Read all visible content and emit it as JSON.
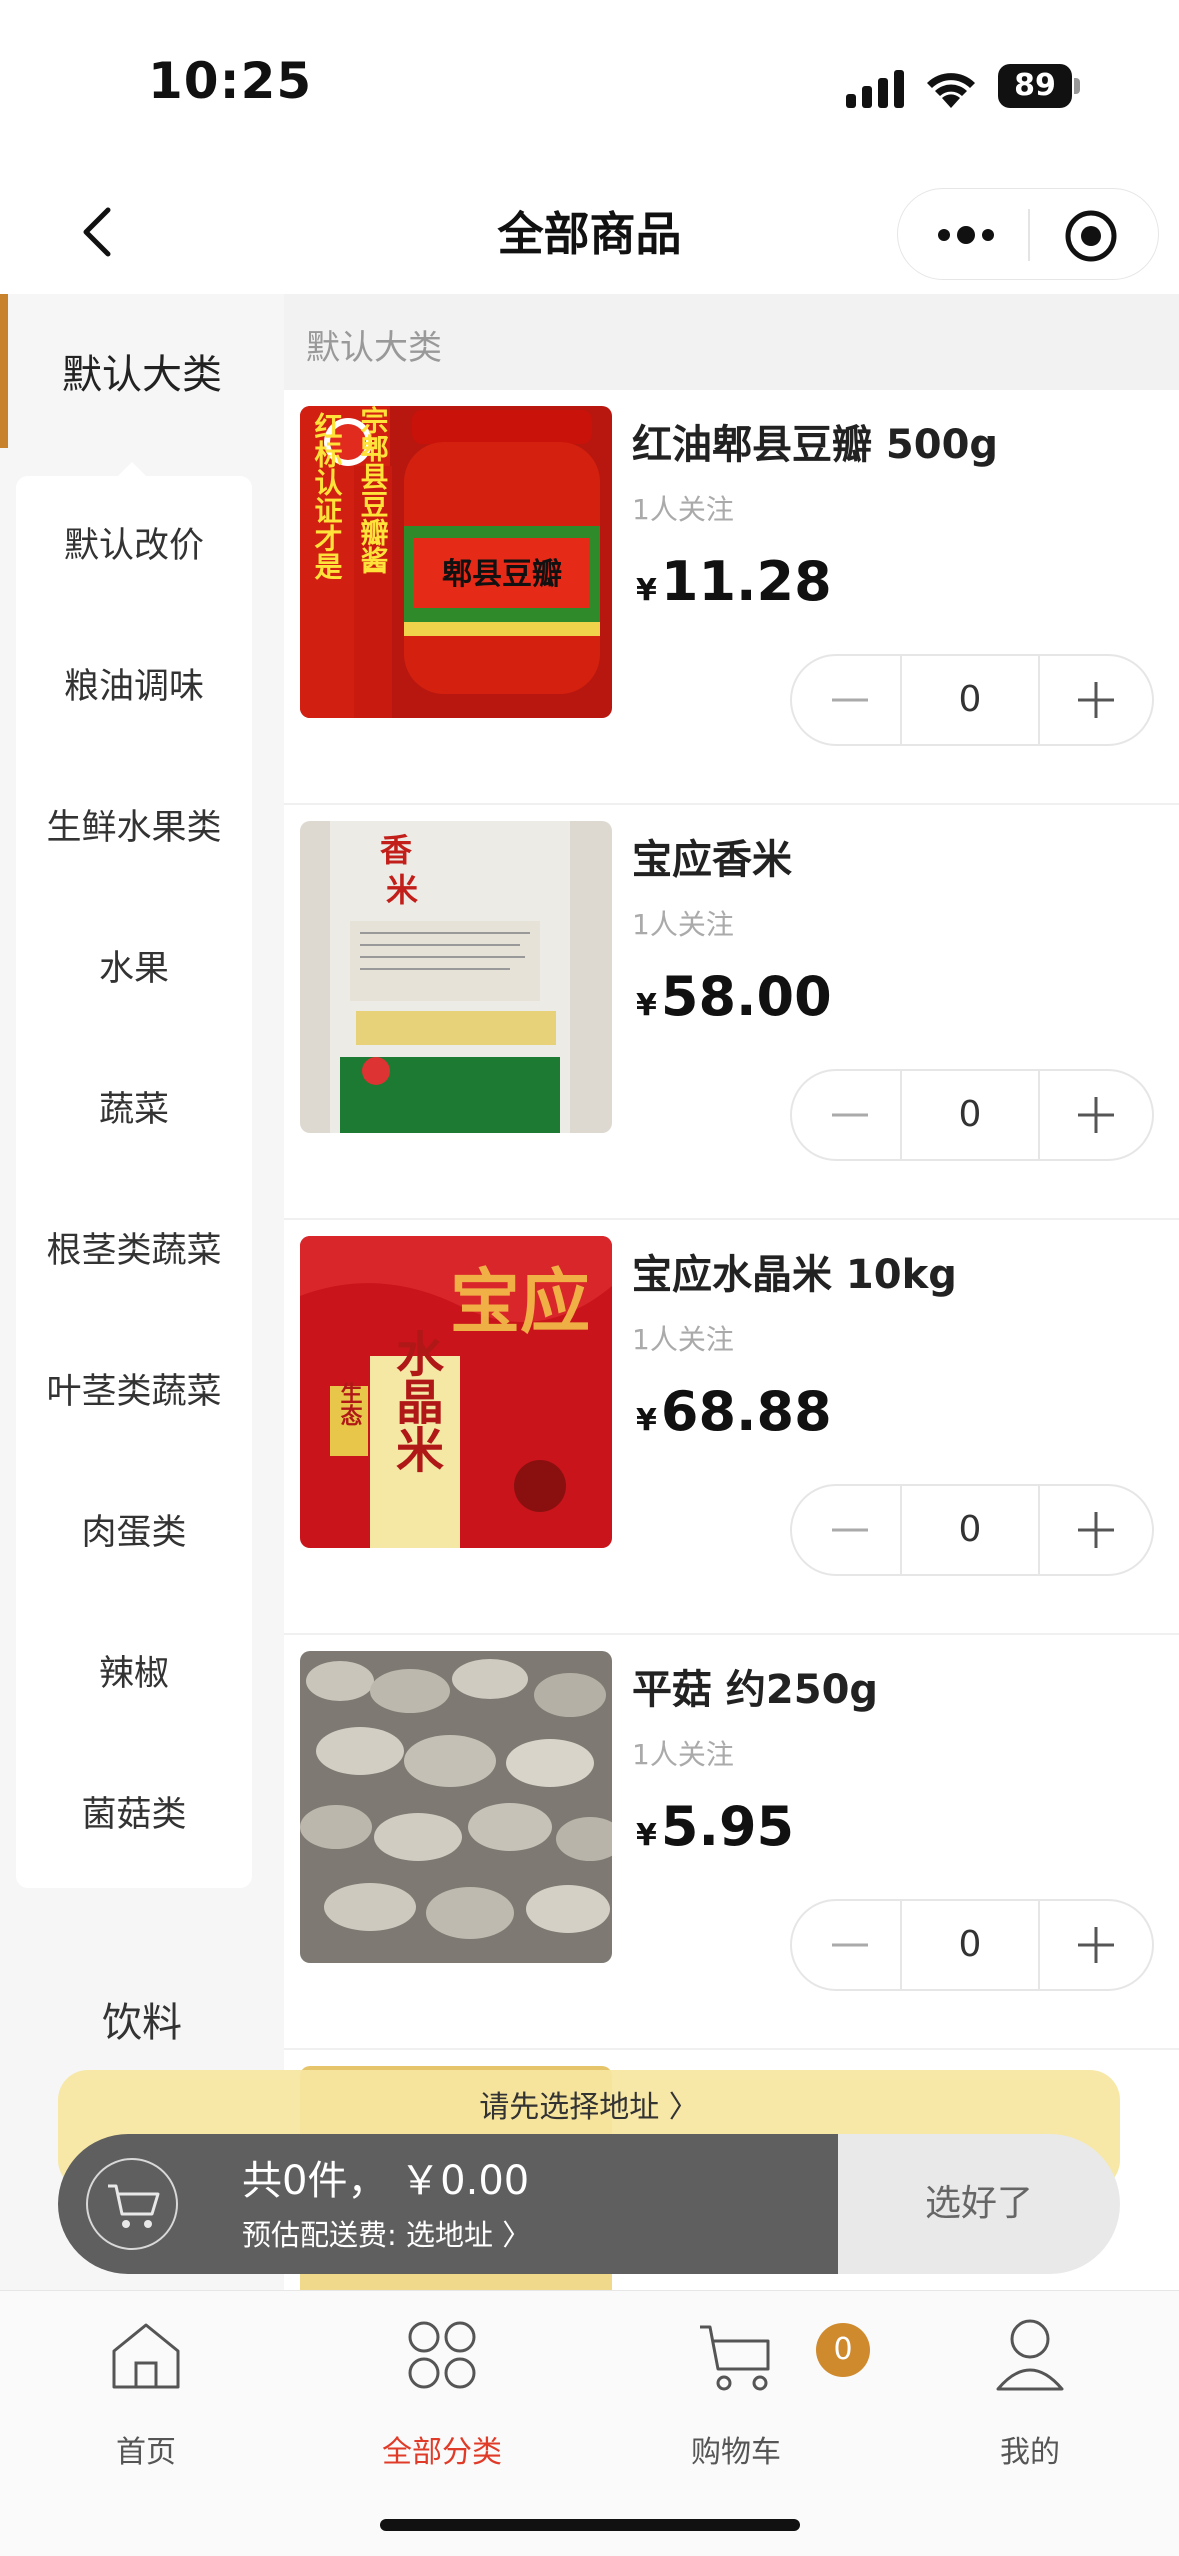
{
  "status_bar": {
    "time": "10:25",
    "battery": "89"
  },
  "nav": {
    "title": "全部商品"
  },
  "sidebar": {
    "active": "默认大类",
    "sub_items": [
      "默认改价",
      "粮油调味",
      "生鲜水果类",
      "水果",
      "蔬菜",
      "根茎类蔬菜",
      "叶茎类蔬菜",
      "肉蛋类",
      "辣椒",
      "菌菇类"
    ],
    "bottom_item": "饮料"
  },
  "content": {
    "category_header": "默认大类",
    "products": [
      {
        "name": "红油郫县豆瓣 500g",
        "followers": "1人关注",
        "currency": "¥",
        "price": "11.28",
        "qty": "0"
      },
      {
        "name": "宝应香米",
        "followers": "1人关注",
        "currency": "¥",
        "price": "58.00",
        "qty": "0"
      },
      {
        "name": "宝应水晶米 10kg",
        "followers": "1人关注",
        "currency": "¥",
        "price": "68.88",
        "qty": "0"
      },
      {
        "name": "平菇 约250g",
        "followers": "1人关注",
        "currency": "¥",
        "price": "5.95",
        "qty": "0"
      }
    ],
    "image_text": {
      "doubanjiang_left": "红标认证才是",
      "doubanjiang_mid": "正宗郫县豆瓣酱",
      "doubanjiang_jar": "郫县豆瓣",
      "crystal_rice": "水晶米",
      "crystal_rice_brand": "宝应",
      "crystal_rice_tag": "生态"
    }
  },
  "address_tip": "请先选择地址 〉",
  "cart": {
    "summary": "共0件， ￥0.00",
    "fee": "预估配送费: 选地址 〉",
    "confirm": "选好了"
  },
  "tab_bar": {
    "tabs": [
      "首页",
      "全部分类",
      "购物车",
      "我的"
    ],
    "active_index": 1,
    "cart_badge": "0"
  },
  "colors": {
    "accent": "#c9822c",
    "active_tab": "#e03b28",
    "badge": "#cf8a2e"
  }
}
